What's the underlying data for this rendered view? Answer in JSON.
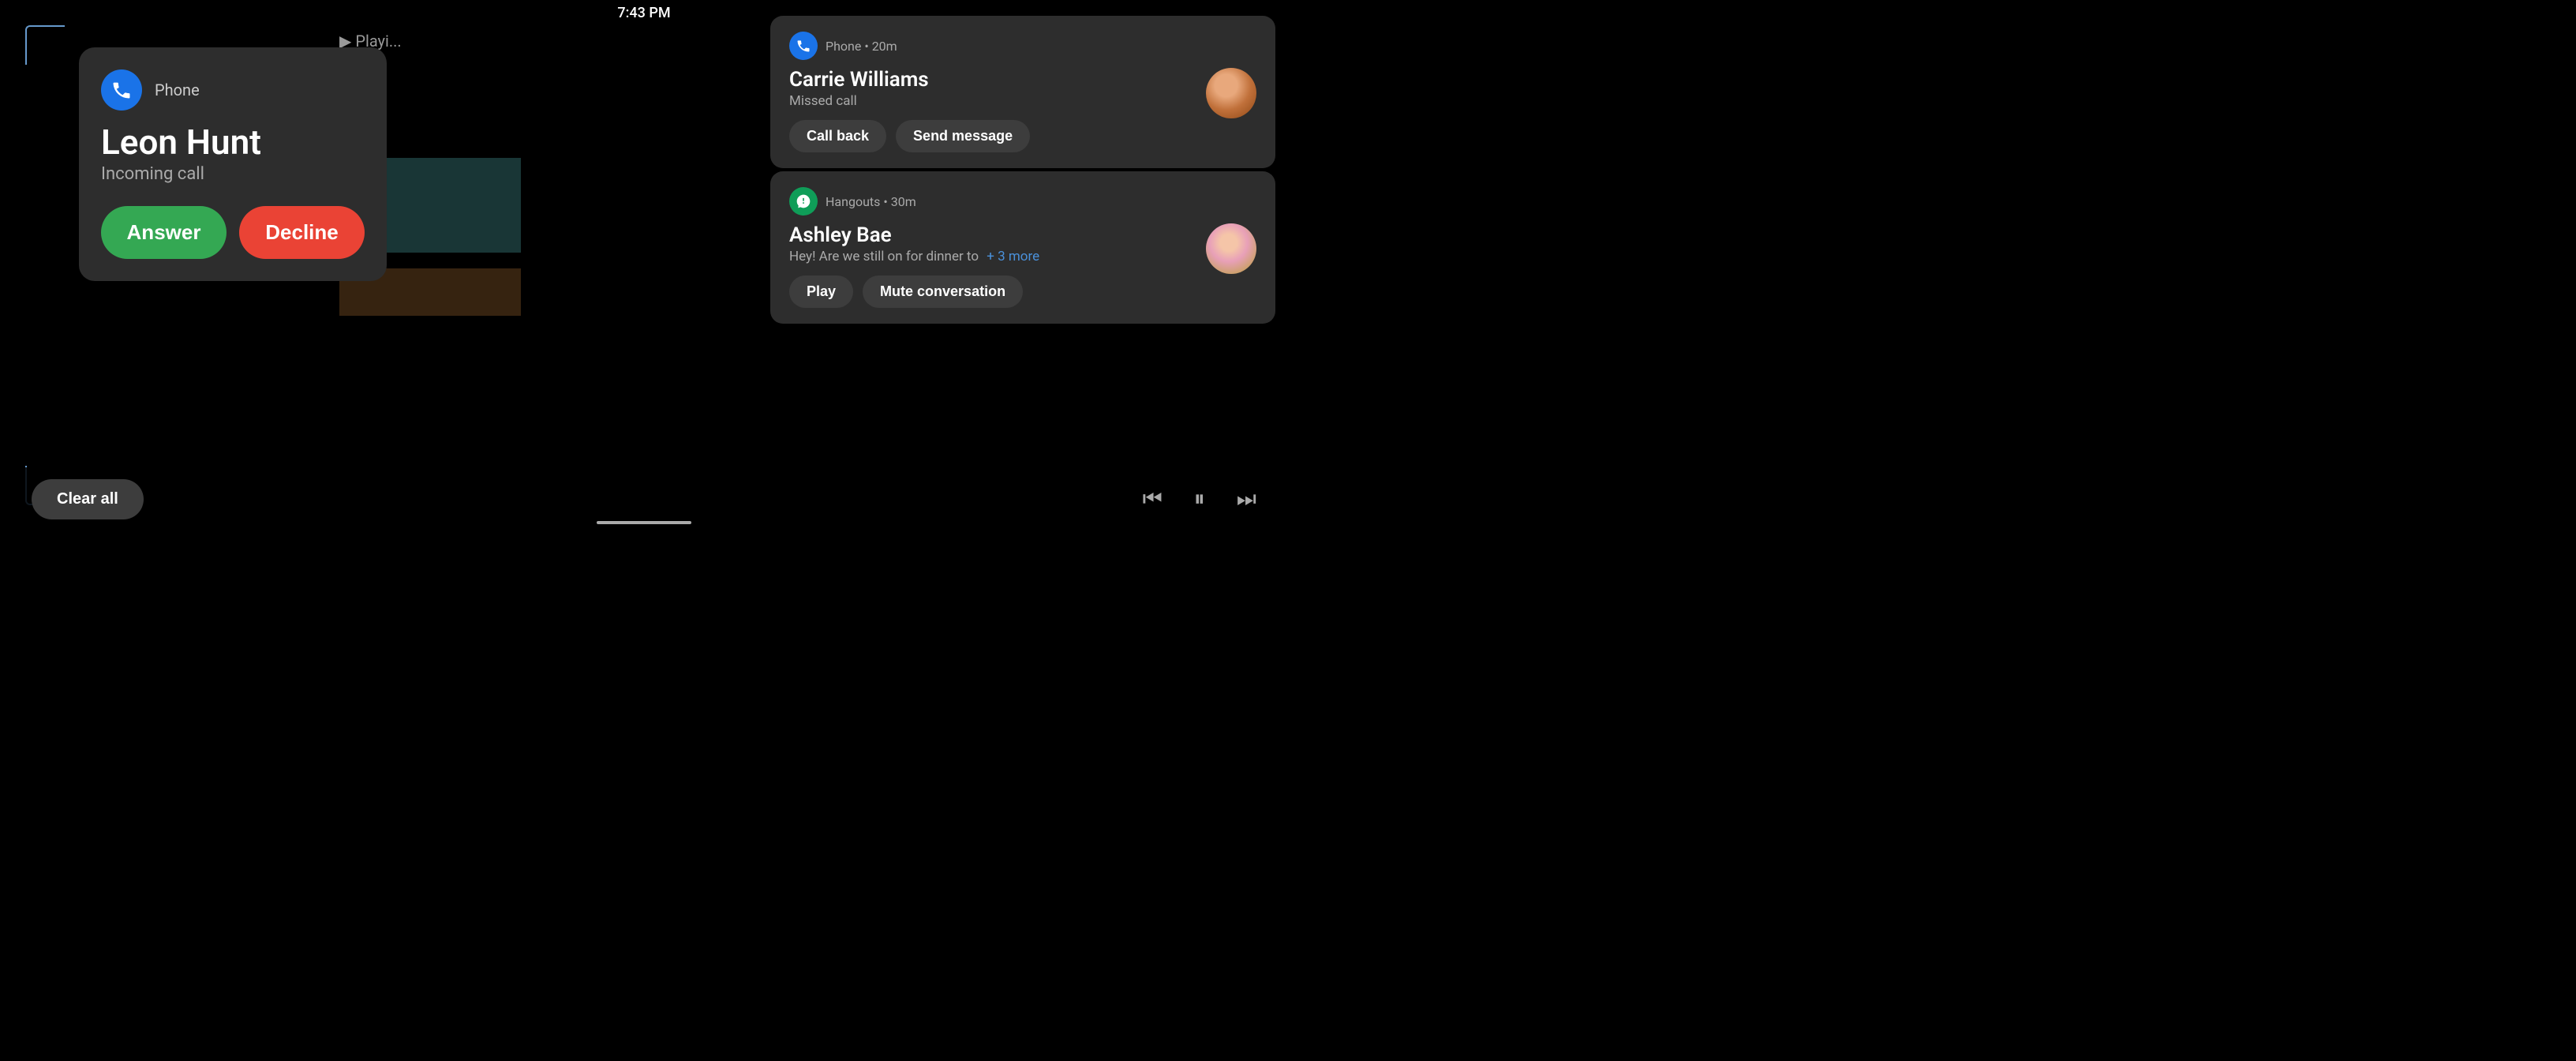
{
  "statusBar": {
    "time": "7:43 PM"
  },
  "dpLabel": "8dp",
  "callCard": {
    "appName": "Phone",
    "callerName": "Leon Hunt",
    "callStatus": "Incoming call",
    "answerLabel": "Answer",
    "declineLabel": "Decline"
  },
  "notifications": [
    {
      "id": "notif-1",
      "appName": "Phone",
      "appIconType": "phone",
      "timeAgo": "20m",
      "contactName": "Carrie Williams",
      "subText": "Missed call",
      "moreText": null,
      "actions": [
        "Call back",
        "Send message"
      ],
      "hasAvatar": true,
      "avatarType": "carrie"
    },
    {
      "id": "notif-2",
      "appName": "Hangouts",
      "appIconType": "hangouts",
      "timeAgo": "30m",
      "contactName": "Ashley Bae",
      "subText": "Hey! Are we still on for dinner to",
      "moreText": "+ 3 more",
      "actions": [
        "Play",
        "Mute conversation"
      ],
      "hasAvatar": true,
      "avatarType": "ashley"
    }
  ],
  "bottomBar": {
    "clearAllLabel": "Clear all",
    "prevIcon": "⏮",
    "pauseIcon": "⏸",
    "nextIcon": "⏭"
  },
  "playingHint": "▶ Playi..."
}
